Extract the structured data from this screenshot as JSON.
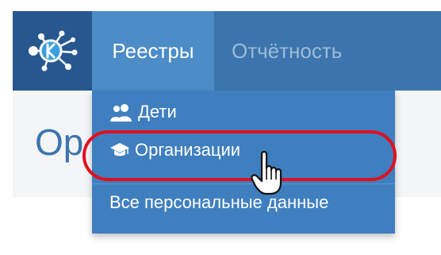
{
  "header": {
    "nav": [
      {
        "label": "Реестры",
        "active": true
      },
      {
        "label": "Отчётность",
        "active": false
      }
    ]
  },
  "page": {
    "title_fragment": "Ор"
  },
  "dropdown": {
    "items": [
      {
        "label": "Дети",
        "icon": "users-icon"
      },
      {
        "label": "Организации",
        "icon": "graduation-cap-icon"
      },
      {
        "label": "Все персональные данные",
        "icon": ""
      }
    ]
  },
  "colors": {
    "topbar": "#3c75ad",
    "logo_bg": "#27578f",
    "active_nav": "#4c8cc7",
    "dropdown_bg": "#3f7fbf",
    "highlight": "#e0101f",
    "title": "#3c75ad"
  }
}
